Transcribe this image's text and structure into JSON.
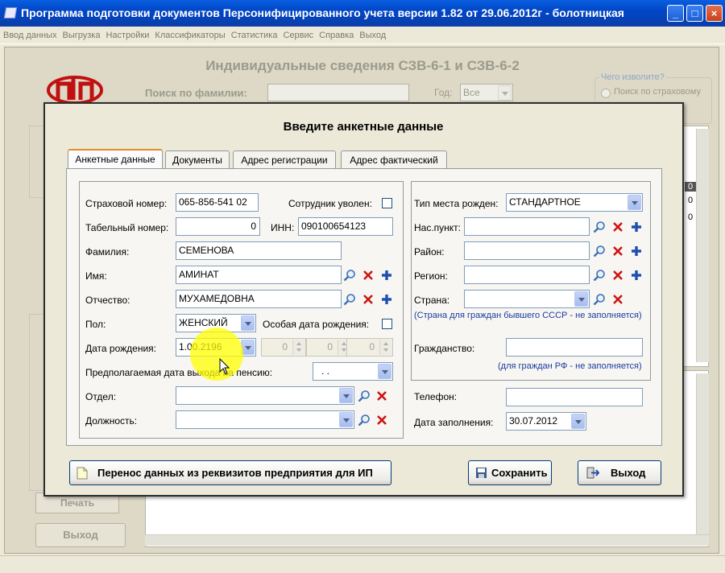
{
  "window": {
    "title": "Программа подготовки документов Персонифицированного учета версии 1.82 от 29.06.2012г - болотницкая"
  },
  "menu": [
    "Ввод данных",
    "Выгрузка",
    "Настройки",
    "Классификаторы",
    "Статистика",
    "Сервис",
    "Справка",
    "Выход"
  ],
  "background": {
    "title": "Индивидуальные сведения СЗВ-6-1 и СЗВ-6-2",
    "search_label": "Поиск по фамилии:",
    "year_label": "Год:",
    "year_value": "Все",
    "group_title": "Чего изволите?",
    "radio_label": "Поиск по страховому",
    "grid_values": [
      "0",
      "0",
      "0"
    ],
    "print_label": "Печать",
    "exit_label": "Выход"
  },
  "dialog": {
    "title": "Введите анкетные данные",
    "tabs": [
      "Анкетные данные",
      "Документы",
      "Адрес регистрации",
      "Адрес фактический"
    ],
    "left": {
      "insurance_label": "Страховой номер:",
      "insurance_value": "065-856-541 02",
      "fired_label": "Сотрудник уволен:",
      "tab_num_label": "Табельный номер:",
      "tab_num_value": "0",
      "inn_label": "ИНН:",
      "inn_value": "090100654123",
      "surname_label": "Фамилия:",
      "surname_value": "СЕМЕНОВА",
      "name_label": "Имя:",
      "name_value": "АМИНАТ",
      "patronymic_label": "Отчество:",
      "patronymic_value": "МУХАМЕДОВНА",
      "sex_label": "Пол:",
      "sex_value": "ЖЕНСКИЙ",
      "special_date_label": "Особая дата рождения:",
      "birth_label": "Дата рождения:",
      "birth_value": "1.00.2196",
      "spin_values": [
        "0",
        "0",
        "0"
      ],
      "pension_label": "Предполагаемая дата выхода на пенсию:",
      "pension_value": ". .",
      "dept_label": "Отдел:",
      "dept_value": "",
      "position_label": "Должность:",
      "position_value": ""
    },
    "right": {
      "birthplace_type_label": "Тип места рожден:",
      "birthplace_type_value": "СТАНДАРТНОЕ",
      "locality_label": "Нас.пункт:",
      "district_label": "Район:",
      "region_label": "Регион:",
      "country_label": "Страна:",
      "country_hint": "(Страна для граждан бывшего СССР - не заполняется)",
      "citizenship_label": "Гражданство:",
      "citizenship_hint": "(для граждан РФ - не заполняется)",
      "phone_label": "Телефон:",
      "phone_value": "",
      "fill_date_label": "Дата заполнения:",
      "fill_date_value": "30.07.2012"
    },
    "buttons": {
      "transfer": "Перенос данных из реквизитов предприятия для ИП",
      "save": "Сохранить",
      "exit": "Выход"
    }
  },
  "colors": {
    "accent": "#0a5fe0",
    "search": "#3b6fb6",
    "delete": "#cc1111",
    "add": "#1f4fb0"
  },
  "icons": [
    "search-icon",
    "delete-icon",
    "add-icon",
    "save-icon",
    "exit-icon",
    "document-icon"
  ]
}
